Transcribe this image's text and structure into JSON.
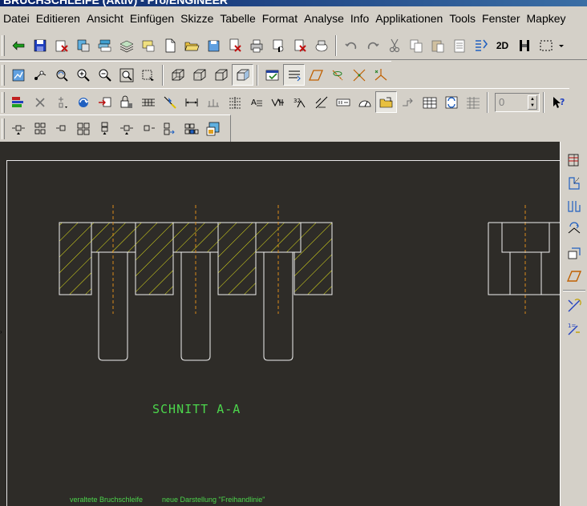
{
  "window": {
    "title": "BRUCHSCHLEIFE (Aktiv) - Pro/ENGINEER"
  },
  "menu": {
    "items": [
      "Datei",
      "Editieren",
      "Ansicht",
      "Einfügen",
      "Skizze",
      "Tabelle",
      "Format",
      "Analyse",
      "Info",
      "Applikationen",
      "Tools",
      "Fenster",
      "Mapkey"
    ]
  },
  "toolbar": {
    "view_2d_label": "2D",
    "spin_value": "0",
    "help_label": "?"
  },
  "drawing": {
    "section_label": "SCHNITT A-A",
    "note_left": "veraltete Bruchschleife",
    "note_right": "neue Darstellung \"Freihandlinie\""
  },
  "colors": {
    "background": "#2e2c28",
    "hatch": "#e6e619",
    "geometry": "#f0f0f0",
    "centerline": "#d98a1a",
    "text": "#4cd64c"
  },
  "icons": {
    "row1": [
      "flag-icon",
      "save-icon",
      "print-setup-icon",
      "erase-icon",
      "layers-icon",
      "layer-cake-icon",
      "new-file-icon",
      "open-icon",
      "save-copy-icon",
      "print-icon",
      "print-preview-icon",
      "print-all-icon",
      "mail-icon",
      "undo-icon",
      "redo-icon",
      "cut-icon",
      "copy-icon",
      "paste-icon",
      "paste-special-icon",
      "regenerate-icon",
      "view-2d-icon",
      "orient-icon",
      "selection-box-icon"
    ],
    "row2": [
      "repaint-icon",
      "spin-center-icon",
      "refit-icon",
      "zoom-in-icon",
      "zoom-out-icon",
      "zoom-window-icon",
      "orient-view-icon",
      "wireframe-icon",
      "hidden-line-icon",
      "no-hidden-icon",
      "shading-icon",
      "layer-status-icon",
      "draw-lines-icon",
      "datum-plane-icon",
      "datum-axis-icon",
      "datum-point-icon",
      "datum-csys-icon"
    ],
    "row3": [
      "layer-filter-icon",
      "delete-icon",
      "insert-icon",
      "refresh-icon",
      "move-icon",
      "lock-icon",
      "table-icon",
      "pin-icon",
      "dimension-icon",
      "ordinate-icon",
      "baseline-icon",
      "note-icon",
      "surface-finish-icon",
      "tolerance-icon",
      "weld-icon",
      "ratio-icon",
      "symbol-icon",
      "datum-target-icon",
      "folder-open-icon",
      "merge-icon",
      "table-insert-icon",
      "swap-icon",
      "grid-icon",
      "help-pointer-icon"
    ],
    "row4": [
      "align-left-icon",
      "align-right-icon",
      "align-top-icon",
      "align-bottom-icon",
      "align-center-icon",
      "distribute-h-icon",
      "distribute-v-icon",
      "group-icon",
      "ungroup-icon",
      "snap-icon"
    ],
    "right": [
      "sketch-tools-icon",
      "edge-view-icon",
      "projection-icon",
      "transform-icon",
      "offset-icon",
      "parallelogram-icon",
      "symbol-gallery-icon",
      "format-text-icon"
    ]
  }
}
